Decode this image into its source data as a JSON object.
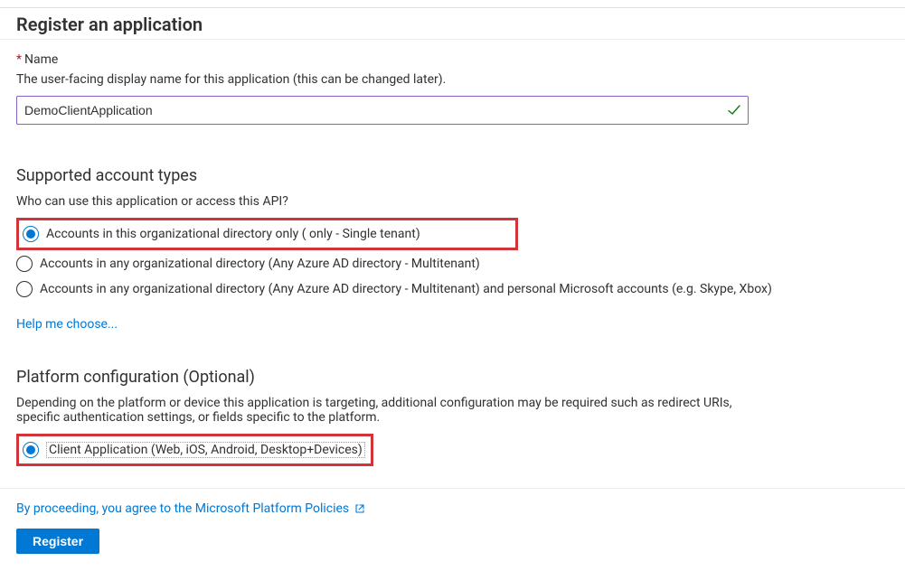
{
  "header": {
    "title": "Register an application"
  },
  "nameSection": {
    "label": "Name",
    "description": "The user-facing display name for this application (this can be changed later).",
    "value": "DemoClientApplication"
  },
  "accountTypes": {
    "heading": "Supported account types",
    "question": "Who can use this application or access this API?",
    "options": [
      {
        "label": "Accounts in this organizational directory only (                                 only - Single tenant)",
        "selected": true
      },
      {
        "label": "Accounts in any organizational directory (Any Azure AD directory - Multitenant)",
        "selected": false
      },
      {
        "label": "Accounts in any organizational directory (Any Azure AD directory - Multitenant) and personal Microsoft accounts (e.g. Skype, Xbox)",
        "selected": false
      }
    ],
    "helpLink": "Help me choose..."
  },
  "platform": {
    "heading": "Platform configuration (Optional)",
    "description": "Depending on the platform or device this application is targeting, additional configuration may be required such as redirect URIs, specific authentication settings, or fields specific to the platform.",
    "options": [
      {
        "label": "Client Application (Web, iOS, Android, Desktop+Devices)",
        "selected": true
      }
    ]
  },
  "footer": {
    "agreement": "By proceeding, you agree to the Microsoft Platform Policies",
    "registerLabel": "Register"
  }
}
